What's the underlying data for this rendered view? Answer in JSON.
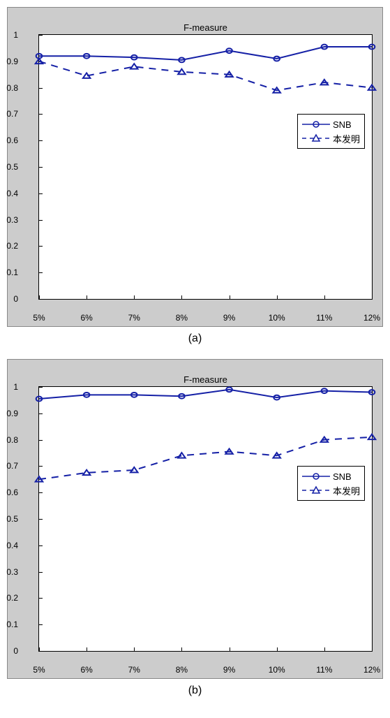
{
  "chart_data": [
    {
      "id": "a",
      "type": "line",
      "title": "F-measure",
      "sublabel": "(a)",
      "categories": [
        "5%",
        "6%",
        "7%",
        "8%",
        "9%",
        "10%",
        "11%",
        "12%"
      ],
      "yticks": [
        "0",
        "0.1",
        "0.2",
        "0.3",
        "0.4",
        "0.5",
        "0.6",
        "0.7",
        "0.8",
        "0.9",
        "1"
      ],
      "ylim": [
        0,
        1
      ],
      "legend_top_frac": 0.3,
      "series": [
        {
          "name": "SNB",
          "style": "solid",
          "marker": "circle",
          "values": [
            0.92,
            0.92,
            0.915,
            0.905,
            0.94,
            0.91,
            0.955,
            0.955
          ]
        },
        {
          "name": "本发明",
          "style": "dashed",
          "marker": "triangle",
          "values": [
            0.9,
            0.845,
            0.88,
            0.86,
            0.85,
            0.79,
            0.82,
            0.8
          ]
        }
      ]
    },
    {
      "id": "b",
      "type": "line",
      "title": "F-measure",
      "sublabel": "(b)",
      "categories": [
        "5%",
        "6%",
        "7%",
        "8%",
        "9%",
        "10%",
        "11%",
        "12%"
      ],
      "yticks": [
        "0",
        "0.1",
        "0.2",
        "0.3",
        "0.4",
        "0.5",
        "0.6",
        "0.7",
        "0.8",
        "0.9",
        "1"
      ],
      "ylim": [
        0,
        1
      ],
      "legend_top_frac": 0.3,
      "series": [
        {
          "name": "SNB",
          "style": "solid",
          "marker": "circle",
          "values": [
            0.955,
            0.97,
            0.97,
            0.965,
            0.99,
            0.96,
            0.985,
            0.98
          ]
        },
        {
          "name": "本发明",
          "style": "dashed",
          "marker": "triangle",
          "values": [
            0.65,
            0.675,
            0.685,
            0.74,
            0.755,
            0.74,
            0.8,
            0.81
          ]
        }
      ]
    }
  ]
}
